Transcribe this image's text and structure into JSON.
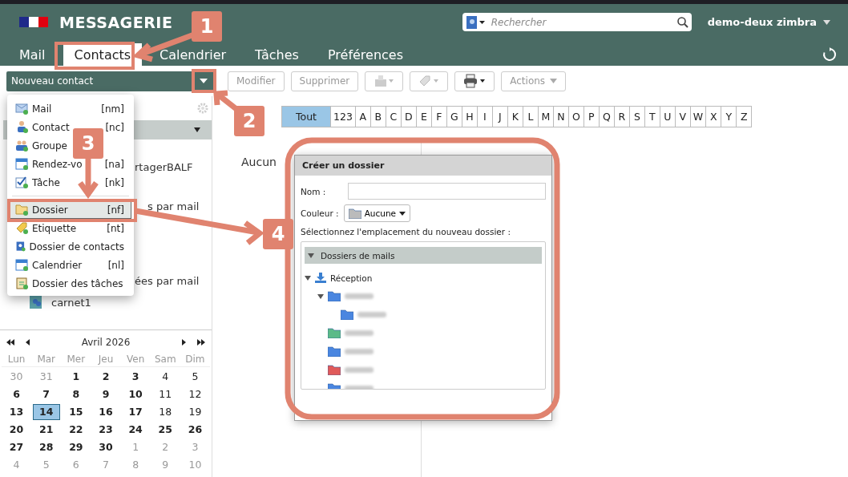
{
  "header": {
    "app_title": "MESSAGERIE",
    "search": {
      "placeholder": "Rechercher"
    },
    "user": "demo-deux zimbra"
  },
  "tabs": [
    {
      "label": "Mail",
      "selected": false
    },
    {
      "label": "Contacts",
      "selected": true
    },
    {
      "label": "Calendrier",
      "selected": false
    },
    {
      "label": "Tâches",
      "selected": false
    },
    {
      "label": "Préférences",
      "selected": false
    }
  ],
  "toolbar": {
    "new_button": "Nouveau contact",
    "buttons": [
      "Modifier",
      "Supprimer"
    ],
    "actions": "Actions"
  },
  "new_menu": [
    {
      "kind": "item",
      "label": "Mail",
      "shortcut": "[nm]",
      "selected": false
    },
    {
      "kind": "item",
      "label": "Contact",
      "shortcut": "[nc]",
      "selected": false
    },
    {
      "kind": "item",
      "label": "Groupe",
      "selected": false
    },
    {
      "kind": "item",
      "label": "Rendez-vo",
      "shortcut": "[na]",
      "selected": false
    },
    {
      "kind": "item",
      "label": "Tâche",
      "shortcut": "[nk]",
      "selected": false
    },
    {
      "kind": "separator"
    },
    {
      "kind": "item",
      "label": "Dossier",
      "shortcut": "[nf]",
      "selected": true
    },
    {
      "kind": "item",
      "label": "Etiquette",
      "shortcut": "[nt]",
      "selected": false
    },
    {
      "kind": "item",
      "label": "Dossier de contacts",
      "selected": false
    },
    {
      "kind": "item",
      "label": "Calendrier",
      "shortcut": "[nl]",
      "selected": false
    },
    {
      "kind": "item",
      "label": "Dossier des tâches",
      "selected": false
    }
  ],
  "sidebar": {
    "items": [
      {
        "kind": "partial",
        "label": "rtagerBALF"
      },
      {
        "kind": "partial",
        "label": "s par mail"
      },
      {
        "kind": "partial",
        "label": "ées par mail"
      },
      {
        "kind": "addressbook",
        "label": "carnet1"
      }
    ]
  },
  "mini_calendar": {
    "title": "Avril 2026",
    "weekdays": [
      "Lun",
      "Mar",
      "Mer",
      "Jeu",
      "Ven",
      "Sam",
      "Dim"
    ],
    "weeks": [
      [
        {
          "day": "30",
          "kind": "muted",
          "selected": false
        },
        {
          "day": "31",
          "kind": "muted",
          "selected": false
        },
        {
          "day": "1",
          "kind": "bold",
          "selected": false
        },
        {
          "day": "2",
          "kind": "bold",
          "selected": false
        },
        {
          "day": "3",
          "kind": "bold",
          "selected": false
        },
        {
          "day": "4",
          "kind": "normal",
          "selected": false
        },
        {
          "day": "5",
          "kind": "normal",
          "selected": false
        }
      ],
      [
        {
          "day": "6",
          "kind": "bold",
          "selected": false
        },
        {
          "day": "7",
          "kind": "bold",
          "selected": false
        },
        {
          "day": "8",
          "kind": "bold",
          "selected": false
        },
        {
          "day": "9",
          "kind": "bold",
          "selected": false
        },
        {
          "day": "10",
          "kind": "bold",
          "selected": false
        },
        {
          "day": "11",
          "kind": "normal",
          "selected": false
        },
        {
          "day": "12",
          "kind": "normal",
          "selected": false
        }
      ],
      [
        {
          "day": "13",
          "kind": "bold",
          "selected": false
        },
        {
          "day": "14",
          "kind": "bold",
          "selected": true
        },
        {
          "day": "15",
          "kind": "bold",
          "selected": false
        },
        {
          "day": "16",
          "kind": "bold",
          "selected": false
        },
        {
          "day": "17",
          "kind": "bold",
          "selected": false
        },
        {
          "day": "18",
          "kind": "normal",
          "selected": false
        },
        {
          "day": "19",
          "kind": "normal",
          "selected": false
        }
      ],
      [
        {
          "day": "20",
          "kind": "bold",
          "selected": false
        },
        {
          "day": "21",
          "kind": "bold",
          "selected": false
        },
        {
          "day": "22",
          "kind": "bold",
          "selected": false
        },
        {
          "day": "23",
          "kind": "bold",
          "selected": false
        },
        {
          "day": "24",
          "kind": "bold",
          "selected": false
        },
        {
          "day": "25",
          "kind": "bold",
          "selected": false
        },
        {
          "day": "26",
          "kind": "bold",
          "selected": false
        }
      ],
      [
        {
          "day": "27",
          "kind": "bold",
          "selected": false
        },
        {
          "day": "28",
          "kind": "bold",
          "selected": false
        },
        {
          "day": "29",
          "kind": "bold",
          "selected": false
        },
        {
          "day": "30",
          "kind": "bold",
          "selected": false
        },
        {
          "day": "1",
          "kind": "muted",
          "selected": false
        },
        {
          "day": "2",
          "kind": "muted",
          "selected": false
        },
        {
          "day": "3",
          "kind": "muted",
          "selected": false
        }
      ],
      [
        {
          "day": "4",
          "kind": "muted",
          "selected": false
        },
        {
          "day": "5",
          "kind": "muted",
          "selected": false
        },
        {
          "day": "6",
          "kind": "muted",
          "selected": false
        },
        {
          "day": "7",
          "kind": "muted",
          "selected": false
        },
        {
          "day": "8",
          "kind": "muted",
          "selected": false
        },
        {
          "day": "9",
          "kind": "muted",
          "selected": false
        },
        {
          "day": "10",
          "kind": "muted",
          "selected": false
        }
      ]
    ]
  },
  "alphabet": [
    {
      "label": "Tout",
      "selected": true
    },
    {
      "label": "123",
      "selected": false
    },
    {
      "label": "A",
      "selected": false
    },
    {
      "label": "B",
      "selected": false
    },
    {
      "label": "C",
      "selected": false
    },
    {
      "label": "D",
      "selected": false
    },
    {
      "label": "E",
      "selected": false
    },
    {
      "label": "F",
      "selected": false
    },
    {
      "label": "G",
      "selected": false
    },
    {
      "label": "H",
      "selected": false
    },
    {
      "label": "I",
      "selected": false
    },
    {
      "label": "J",
      "selected": false
    },
    {
      "label": "K",
      "selected": false
    },
    {
      "label": "L",
      "selected": false
    },
    {
      "label": "M",
      "selected": false
    },
    {
      "label": "N",
      "selected": false
    },
    {
      "label": "O",
      "selected": false
    },
    {
      "label": "P",
      "selected": false
    },
    {
      "label": "Q",
      "selected": false
    },
    {
      "label": "R",
      "selected": false
    },
    {
      "label": "S",
      "selected": false
    },
    {
      "label": "T",
      "selected": false
    },
    {
      "label": "U",
      "selected": false
    },
    {
      "label": "V",
      "selected": false
    },
    {
      "label": "W",
      "selected": false
    },
    {
      "label": "X",
      "selected": false
    },
    {
      "label": "Y",
      "selected": false
    },
    {
      "label": "Z",
      "selected": false
    }
  ],
  "empty_message": "Aucun",
  "dialog": {
    "title": "Créer un dossier",
    "name_label": "Nom :",
    "color_label": "Couleur :",
    "color_value": "Aucune",
    "location_label": "Sélectionnez l'emplacement du nouveau dossier :",
    "tree": {
      "header": "Dossiers de mails",
      "expanded": true,
      "items": [
        {
          "label": "Réception",
          "expanded": true,
          "children": [
            {
              "color": "#4a86e0",
              "expanded": true,
              "children": [
                {
                  "color": "#4a86e0"
                }
              ]
            },
            {
              "color": "#5cba87"
            },
            {
              "color": "#4a86e0"
            },
            {
              "color": "#e05a5a"
            },
            {
              "color": "#4a86e0"
            }
          ]
        }
      ]
    }
  },
  "annotations": [
    "1",
    "2",
    "3",
    "4"
  ]
}
